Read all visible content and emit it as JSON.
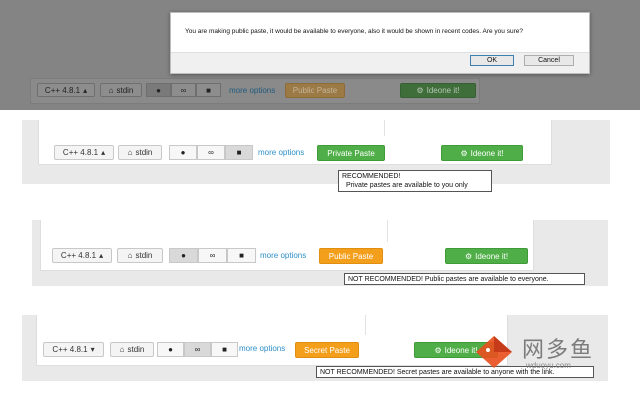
{
  "dialog": {
    "message": "You are making public paste, it would be available to everyone, also it would be shown in recent codes. Are you sure?",
    "ok_label": "OK",
    "cancel_label": "Cancel"
  },
  "panels": [
    {
      "language_label": "C++ 4.8.1",
      "stdin_label": "stdin",
      "more_options_label": "more options",
      "paste_label": "Public Paste",
      "submit_label": "Ideone it!"
    },
    {
      "language_label": "C++ 4.8.1",
      "stdin_label": "stdin",
      "more_options_label": "more options",
      "paste_label": "Private Paste",
      "submit_label": "Ideone it!",
      "tooltip_line1": "RECOMMENDED!",
      "tooltip_line2": "Private pastes are available to you only"
    },
    {
      "language_label": "C++ 4.8.1",
      "stdin_label": "stdin",
      "more_options_label": "more options",
      "paste_label": "Public Paste",
      "submit_label": "Ideone it!",
      "tooltip_line1": "NOT RECOMMENDED! Public pastes are available to everyone."
    },
    {
      "language_label": "C++ 4.8.1",
      "stdin_label": "stdin",
      "more_options_label": "more options",
      "paste_label": "Secret Paste",
      "submit_label": "Ideone it!",
      "tooltip_line1": "NOT RECOMMENDED! Secret pastes are available to anyone with the link."
    }
  ],
  "watermark": {
    "text": "网多鱼",
    "url": "wduoyu.com"
  },
  "colors": {
    "green": "#4fae47",
    "orange": "#f49f1c",
    "link": "#2d8fc9",
    "overlay": "#7f7f7f"
  }
}
